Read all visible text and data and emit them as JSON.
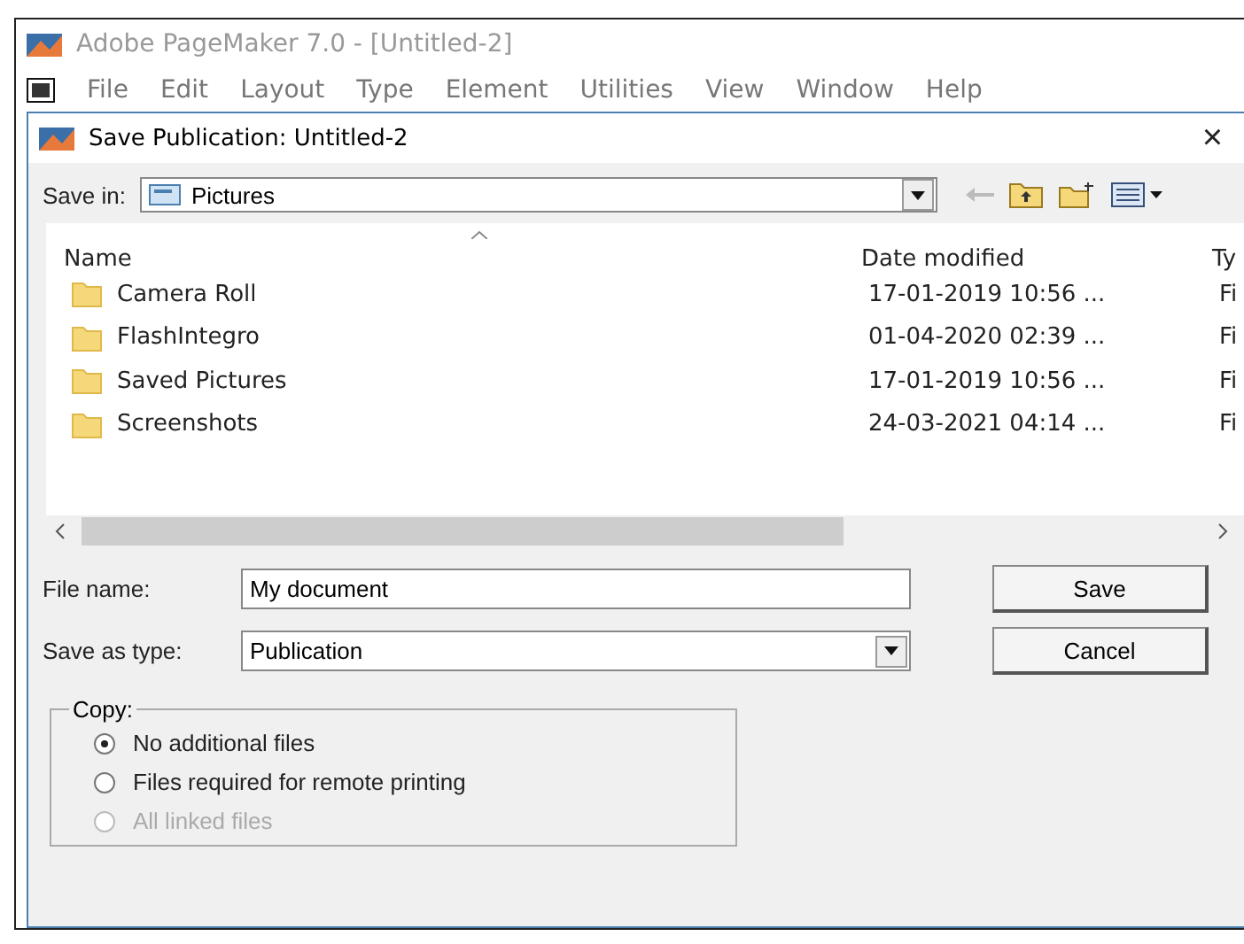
{
  "app_window": {
    "title": "Adobe PageMaker 7.0 - [Untitled-2]"
  },
  "menu_bar": [
    "File",
    "Edit",
    "Layout",
    "Type",
    "Element",
    "Utilities",
    "View",
    "Window",
    "Help"
  ],
  "dialog": {
    "title": "Save Publication: Untitled-2",
    "close": "×",
    "save_in": {
      "label": "Save in:",
      "value": "Pictures"
    },
    "file_list": {
      "columns": [
        "Name",
        "Date modified",
        "Ty"
      ],
      "rows": [
        {
          "name": "Camera Roll",
          "date": "17-01-2019 10:56 ...",
          "type": "Fi"
        },
        {
          "name": "FlashIntegro",
          "date": "01-04-2020 02:39 ...",
          "type": "Fi"
        },
        {
          "name": "Saved Pictures",
          "date": "17-01-2019 10:56 ...",
          "type": "Fi"
        },
        {
          "name": "Screenshots",
          "date": "24-03-2021 04:14 ...",
          "type": "Fi"
        }
      ]
    },
    "file_name": {
      "label": "File name:",
      "value": "My document"
    },
    "save_as_type": {
      "label": "Save as type:",
      "value": "Publication"
    },
    "buttons": [
      "Save",
      "Cancel"
    ],
    "copy_group": {
      "title": "Copy:",
      "options": [
        {
          "label": "No additional files",
          "selected": true,
          "disabled": false
        },
        {
          "label": "Files required for remote printing",
          "selected": false,
          "disabled": false
        },
        {
          "label": "All linked files",
          "selected": false,
          "disabled": true
        }
      ]
    }
  }
}
